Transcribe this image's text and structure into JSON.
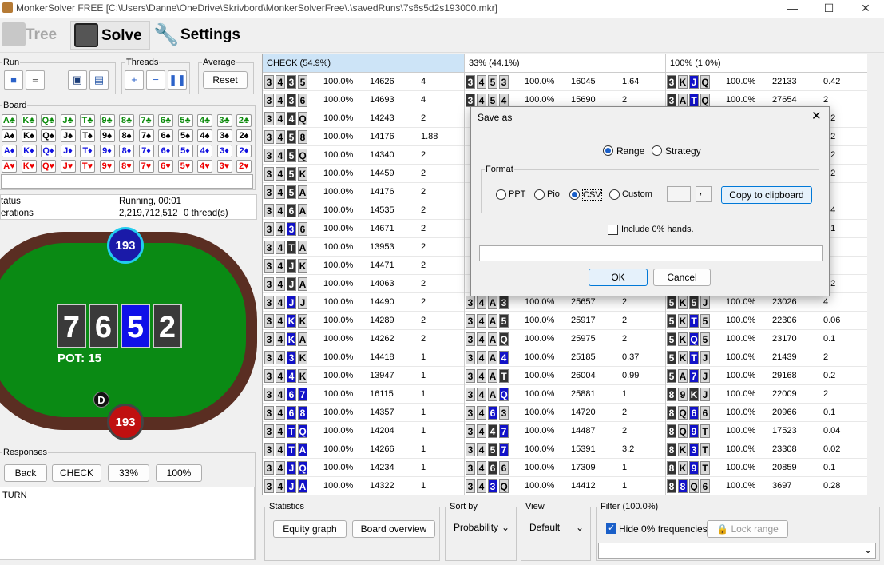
{
  "window": {
    "title": "MonkerSolver FREE [C:\\Users\\Danne\\OneDrive\\Skrivbord\\MonkerSolverFree\\.\\savedRuns\\7s6s5d2s193000.mkr]"
  },
  "toolbar": {
    "tree": "Tree",
    "solve": "Solve",
    "settings": "Settings"
  },
  "left": {
    "run_label": "Run",
    "threads_label": "Threads",
    "average_label": "Average",
    "reset": "Reset",
    "board_label": "Board",
    "board_rows": [
      {
        "suit": "c",
        "cards": [
          "A♣",
          "K♣",
          "Q♣",
          "J♣",
          "T♣",
          "9♣",
          "8♣",
          "7♣",
          "6♣",
          "5♣",
          "4♣",
          "3♣",
          "2♣"
        ]
      },
      {
        "suit": "s",
        "cards": [
          "A♠",
          "K♠",
          "Q♠",
          "J♠",
          "T♠",
          "9♠",
          "8♠",
          "7♠",
          "6♠",
          "5♠",
          "4♠",
          "3♠",
          "2♠"
        ]
      },
      {
        "suit": "d",
        "cards": [
          "A♦",
          "K♦",
          "Q♦",
          "J♦",
          "T♦",
          "9♦",
          "8♦",
          "7♦",
          "6♦",
          "5♦",
          "4♦",
          "3♦",
          "2♦"
        ]
      },
      {
        "suit": "h",
        "cards": [
          "A♥",
          "K♥",
          "Q♥",
          "J♥",
          "T♥",
          "9♥",
          "8♥",
          "7♥",
          "6♥",
          "5♥",
          "4♥",
          "3♥",
          "2♥"
        ]
      }
    ],
    "status_label": "tatus",
    "status_value": "Running, 00:01",
    "iter_label": "erations",
    "iter_value": "2,219,712,512",
    "threads_value": "0 thread(s)",
    "board_cards": [
      "7",
      "6",
      "5",
      "2"
    ],
    "pot": "POT: 15",
    "top_stack": "193",
    "bottom_stack": "193",
    "dealer": "D",
    "responses_label": "Responses",
    "resp_buttons": [
      "Back",
      "CHECK",
      "33%",
      "100%"
    ],
    "street": "TURN"
  },
  "grid": {
    "headers": [
      "CHECK (54.9%)",
      "33% (44.1%)",
      "100% (1.0%)"
    ],
    "col1": [
      {
        "h": [
          "3",
          "4",
          "3",
          "5"
        ],
        "c": [
          "n",
          "n",
          "dk",
          "n"
        ],
        "p": "100.0%",
        "n": "14626",
        "v": "4"
      },
      {
        "h": [
          "3",
          "4",
          "3",
          "6"
        ],
        "c": [
          "n",
          "n",
          "dk",
          "n"
        ],
        "p": "100.0%",
        "n": "14693",
        "v": "4"
      },
      {
        "h": [
          "3",
          "4",
          "4",
          "Q"
        ],
        "c": [
          "n",
          "n",
          "dk",
          "n"
        ],
        "p": "100.0%",
        "n": "14243",
        "v": "2"
      },
      {
        "h": [
          "3",
          "4",
          "5",
          "8"
        ],
        "c": [
          "n",
          "n",
          "dk",
          "n"
        ],
        "p": "100.0%",
        "n": "14176",
        "v": "1.88"
      },
      {
        "h": [
          "3",
          "4",
          "5",
          "Q"
        ],
        "c": [
          "n",
          "n",
          "dk",
          "n"
        ],
        "p": "100.0%",
        "n": "14340",
        "v": "2"
      },
      {
        "h": [
          "3",
          "4",
          "5",
          "K"
        ],
        "c": [
          "n",
          "n",
          "dk",
          "n"
        ],
        "p": "100.0%",
        "n": "14459",
        "v": "2"
      },
      {
        "h": [
          "3",
          "4",
          "5",
          "A"
        ],
        "c": [
          "n",
          "n",
          "dk",
          "n"
        ],
        "p": "100.0%",
        "n": "14176",
        "v": "2"
      },
      {
        "h": [
          "3",
          "4",
          "6",
          "A"
        ],
        "c": [
          "n",
          "n",
          "dk",
          "n"
        ],
        "p": "100.0%",
        "n": "14535",
        "v": "2"
      },
      {
        "h": [
          "3",
          "4",
          "3",
          "6"
        ],
        "c": [
          "n",
          "n",
          "b",
          "n"
        ],
        "p": "100.0%",
        "n": "14671",
        "v": "2"
      },
      {
        "h": [
          "3",
          "4",
          "T",
          "A"
        ],
        "c": [
          "n",
          "n",
          "dk",
          "n"
        ],
        "p": "100.0%",
        "n": "13953",
        "v": "2"
      },
      {
        "h": [
          "3",
          "4",
          "J",
          "K"
        ],
        "c": [
          "n",
          "n",
          "dk",
          "n"
        ],
        "p": "100.0%",
        "n": "14471",
        "v": "2"
      },
      {
        "h": [
          "3",
          "4",
          "J",
          "A"
        ],
        "c": [
          "n",
          "n",
          "dk",
          "n"
        ],
        "p": "100.0%",
        "n": "14063",
        "v": "2"
      },
      {
        "h": [
          "3",
          "4",
          "J",
          "J"
        ],
        "c": [
          "n",
          "n",
          "b",
          "n"
        ],
        "p": "100.0%",
        "n": "14490",
        "v": "2"
      },
      {
        "h": [
          "3",
          "4",
          "K",
          "K"
        ],
        "c": [
          "n",
          "n",
          "b",
          "n"
        ],
        "p": "100.0%",
        "n": "14289",
        "v": "2"
      },
      {
        "h": [
          "3",
          "4",
          "K",
          "A"
        ],
        "c": [
          "n",
          "n",
          "b",
          "n"
        ],
        "p": "100.0%",
        "n": "14262",
        "v": "2"
      },
      {
        "h": [
          "3",
          "4",
          "3",
          "K"
        ],
        "c": [
          "n",
          "n",
          "b",
          "n"
        ],
        "p": "100.0%",
        "n": "14418",
        "v": "1"
      },
      {
        "h": [
          "3",
          "4",
          "4",
          "K"
        ],
        "c": [
          "n",
          "n",
          "b",
          "n"
        ],
        "p": "100.0%",
        "n": "13947",
        "v": "1"
      },
      {
        "h": [
          "3",
          "4",
          "6",
          "7"
        ],
        "c": [
          "n",
          "n",
          "b",
          "b"
        ],
        "p": "100.0%",
        "n": "16115",
        "v": "1"
      },
      {
        "h": [
          "3",
          "4",
          "6",
          "8"
        ],
        "c": [
          "n",
          "n",
          "b",
          "b"
        ],
        "p": "100.0%",
        "n": "14357",
        "v": "1"
      },
      {
        "h": [
          "3",
          "4",
          "T",
          "Q"
        ],
        "c": [
          "n",
          "n",
          "b",
          "b"
        ],
        "p": "100.0%",
        "n": "14204",
        "v": "1"
      },
      {
        "h": [
          "3",
          "4",
          "T",
          "A"
        ],
        "c": [
          "n",
          "n",
          "b",
          "b"
        ],
        "p": "100.0%",
        "n": "14266",
        "v": "1"
      },
      {
        "h": [
          "3",
          "4",
          "J",
          "Q"
        ],
        "c": [
          "n",
          "n",
          "b",
          "b"
        ],
        "p": "100.0%",
        "n": "14234",
        "v": "1"
      },
      {
        "h": [
          "3",
          "4",
          "J",
          "A"
        ],
        "c": [
          "n",
          "n",
          "b",
          "b"
        ],
        "p": "100.0%",
        "n": "14322",
        "v": "1"
      }
    ],
    "col2": [
      {
        "h": [
          "3",
          "4",
          "5",
          "3"
        ],
        "c": [
          "dk",
          "n",
          "n",
          "n"
        ],
        "p": "100.0%",
        "n": "16045",
        "v": "1.64"
      },
      {
        "h": [
          "3",
          "4",
          "5",
          "4"
        ],
        "c": [
          "dk",
          "n",
          "n",
          "n"
        ],
        "p": "100.0%",
        "n": "15690",
        "v": "2"
      },
      {
        "h": [
          "",
          "",
          "",
          "",
          ""
        ],
        "c": [
          "n",
          "n",
          "n",
          "n"
        ],
        "p": "",
        "n": "",
        "v": ""
      },
      {
        "h": [
          "",
          "",
          "",
          "",
          ""
        ],
        "c": [
          "n",
          "n",
          "n",
          "n"
        ],
        "p": "",
        "n": "",
        "v": ""
      },
      {
        "h": [
          "",
          "",
          "",
          "",
          ""
        ],
        "c": [
          "n",
          "n",
          "n",
          "n"
        ],
        "p": "",
        "n": "",
        "v": ""
      },
      {
        "h": [
          "",
          "",
          "",
          "",
          ""
        ],
        "c": [
          "n",
          "n",
          "n",
          "n"
        ],
        "p": "",
        "n": "",
        "v": ""
      },
      {
        "h": [
          "",
          "",
          "",
          "",
          ""
        ],
        "c": [
          "n",
          "n",
          "n",
          "n"
        ],
        "p": "",
        "n": "",
        "v": ""
      },
      {
        "h": [
          "",
          "",
          "",
          "",
          ""
        ],
        "c": [
          "n",
          "n",
          "n",
          "n"
        ],
        "p": "",
        "n": "",
        "v": ""
      },
      {
        "h": [
          "",
          "",
          "",
          "",
          ""
        ],
        "c": [
          "n",
          "n",
          "n",
          "n"
        ],
        "p": "",
        "n": "",
        "v": ""
      },
      {
        "h": [
          "",
          "",
          "",
          "",
          ""
        ],
        "c": [
          "n",
          "n",
          "n",
          "n"
        ],
        "p": "",
        "n": "",
        "v": ""
      },
      {
        "h": [
          "",
          "",
          "",
          "",
          ""
        ],
        "c": [
          "n",
          "n",
          "n",
          "n"
        ],
        "p": "",
        "n": "",
        "v": ""
      },
      {
        "h": [
          "",
          "",
          "",
          "",
          ""
        ],
        "c": [
          "n",
          "n",
          "n",
          "n"
        ],
        "p": "",
        "n": "",
        "v": ""
      },
      {
        "h": [
          "3",
          "4",
          "A",
          "3"
        ],
        "c": [
          "n",
          "n",
          "n",
          "dk"
        ],
        "p": "100.0%",
        "n": "25657",
        "v": "2"
      },
      {
        "h": [
          "3",
          "4",
          "A",
          "5"
        ],
        "c": [
          "n",
          "n",
          "n",
          "dk"
        ],
        "p": "100.0%",
        "n": "25917",
        "v": "2"
      },
      {
        "h": [
          "3",
          "4",
          "A",
          "Q"
        ],
        "c": [
          "n",
          "n",
          "n",
          "dk"
        ],
        "p": "100.0%",
        "n": "25975",
        "v": "2"
      },
      {
        "h": [
          "3",
          "4",
          "A",
          "4"
        ],
        "c": [
          "n",
          "n",
          "n",
          "b"
        ],
        "p": "100.0%",
        "n": "25185",
        "v": "0.37"
      },
      {
        "h": [
          "3",
          "4",
          "A",
          "T"
        ],
        "c": [
          "n",
          "n",
          "n",
          "dk"
        ],
        "p": "100.0%",
        "n": "26004",
        "v": "0.99"
      },
      {
        "h": [
          "3",
          "4",
          "A",
          "Q"
        ],
        "c": [
          "n",
          "n",
          "n",
          "b"
        ],
        "p": "100.0%",
        "n": "25881",
        "v": "1"
      },
      {
        "h": [
          "3",
          "4",
          "6",
          "3"
        ],
        "c": [
          "n",
          "n",
          "b",
          "n"
        ],
        "p": "100.0%",
        "n": "14720",
        "v": "2"
      },
      {
        "h": [
          "3",
          "4",
          "4",
          "7"
        ],
        "c": [
          "n",
          "n",
          "dk",
          "b"
        ],
        "p": "100.0%",
        "n": "14487",
        "v": "2"
      },
      {
        "h": [
          "3",
          "4",
          "5",
          "7"
        ],
        "c": [
          "n",
          "n",
          "dk",
          "b"
        ],
        "p": "100.0%",
        "n": "15391",
        "v": "3.2"
      },
      {
        "h": [
          "3",
          "4",
          "6",
          "6"
        ],
        "c": [
          "n",
          "n",
          "dk",
          "n"
        ],
        "p": "100.0%",
        "n": "17309",
        "v": "1"
      },
      {
        "h": [
          "3",
          "4",
          "3",
          "Q"
        ],
        "c": [
          "n",
          "n",
          "b",
          "n"
        ],
        "p": "100.0%",
        "n": "14412",
        "v": "1"
      }
    ],
    "col3": [
      {
        "h": [
          "3",
          "K",
          "J",
          "Q"
        ],
        "c": [
          "dk",
          "n",
          "b",
          "n"
        ],
        "p": "100.0%",
        "n": "22133",
        "v": "0.42"
      },
      {
        "h": [
          "3",
          "A",
          "T",
          "Q"
        ],
        "c": [
          "dk",
          "n",
          "b",
          "n"
        ],
        "p": "100.0%",
        "n": "27654",
        "v": "2"
      },
      {
        "h": [
          "",
          "",
          "",
          ""
        ],
        "c": [
          "n",
          "n",
          "n",
          "n"
        ],
        "p": "",
        "n": "",
        "v": ".32"
      },
      {
        "h": [
          "",
          "",
          "",
          ""
        ],
        "c": [
          "n",
          "n",
          "n",
          "n"
        ],
        "p": "",
        "n": "",
        "v": ".02"
      },
      {
        "h": [
          "",
          "",
          "",
          ""
        ],
        "c": [
          "n",
          "n",
          "n",
          "n"
        ],
        "p": "",
        "n": "",
        "v": ".02"
      },
      {
        "h": [
          "",
          "",
          "",
          ""
        ],
        "c": [
          "n",
          "n",
          "n",
          "n"
        ],
        "p": "",
        "n": "",
        "v": ".52"
      },
      {
        "h": [
          "",
          "",
          "",
          ""
        ],
        "c": [
          "n",
          "n",
          "n",
          "n"
        ],
        "p": "",
        "n": "",
        "v": ""
      },
      {
        "h": [
          "",
          "",
          "",
          ""
        ],
        "c": [
          "n",
          "n",
          "n",
          "n"
        ],
        "p": "",
        "n": "",
        "v": ".04"
      },
      {
        "h": [
          "",
          "",
          "",
          ""
        ],
        "c": [
          "n",
          "n",
          "n",
          "n"
        ],
        "p": "",
        "n": "",
        "v": ".01"
      },
      {
        "h": [
          "",
          "",
          "",
          ""
        ],
        "c": [
          "n",
          "n",
          "n",
          "n"
        ],
        "p": "",
        "n": "",
        "v": ""
      },
      {
        "h": [
          "",
          "",
          "",
          ""
        ],
        "c": [
          "n",
          "n",
          "n",
          "n"
        ],
        "p": "",
        "n": "",
        "v": ""
      },
      {
        "h": [
          "",
          "",
          "",
          ""
        ],
        "c": [
          "n",
          "n",
          "n",
          "n"
        ],
        "p": "",
        "n": "",
        "v": ".22"
      },
      {
        "h": [
          "5",
          "K",
          "5",
          "J"
        ],
        "c": [
          "dk",
          "n",
          "dk",
          "n"
        ],
        "p": "100.0%",
        "n": "23026",
        "v": "4"
      },
      {
        "h": [
          "5",
          "K",
          "T",
          "5"
        ],
        "c": [
          "dk",
          "n",
          "b",
          "n"
        ],
        "p": "100.0%",
        "n": "22306",
        "v": "0.06"
      },
      {
        "h": [
          "5",
          "K",
          "Q",
          "5"
        ],
        "c": [
          "dk",
          "n",
          "b",
          "n"
        ],
        "p": "100.0%",
        "n": "23170",
        "v": "0.1"
      },
      {
        "h": [
          "5",
          "K",
          "T",
          "J"
        ],
        "c": [
          "dk",
          "n",
          "b",
          "n"
        ],
        "p": "100.0%",
        "n": "21439",
        "v": "2"
      },
      {
        "h": [
          "5",
          "A",
          "7",
          "J"
        ],
        "c": [
          "dk",
          "n",
          "b",
          "n"
        ],
        "p": "100.0%",
        "n": "29168",
        "v": "0.2"
      },
      {
        "h": [
          "8",
          "9",
          "K",
          "J"
        ],
        "c": [
          "dk",
          "n",
          "dk",
          "n"
        ],
        "p": "100.0%",
        "n": "22009",
        "v": "2"
      },
      {
        "h": [
          "8",
          "Q",
          "6",
          "6"
        ],
        "c": [
          "dk",
          "n",
          "b",
          "n"
        ],
        "p": "100.0%",
        "n": "20966",
        "v": "0.1"
      },
      {
        "h": [
          "8",
          "Q",
          "9",
          "T"
        ],
        "c": [
          "dk",
          "n",
          "b",
          "n"
        ],
        "p": "100.0%",
        "n": "17523",
        "v": "0.04"
      },
      {
        "h": [
          "8",
          "K",
          "3",
          "T"
        ],
        "c": [
          "dk",
          "n",
          "b",
          "n"
        ],
        "p": "100.0%",
        "n": "23308",
        "v": "0.02"
      },
      {
        "h": [
          "8",
          "K",
          "9",
          "T"
        ],
        "c": [
          "dk",
          "n",
          "b",
          "n"
        ],
        "p": "100.0%",
        "n": "20859",
        "v": "0.1"
      },
      {
        "h": [
          "8",
          "8",
          "Q",
          "6"
        ],
        "c": [
          "dk",
          "b",
          "n",
          "n"
        ],
        "p": "100.0%",
        "n": "3697",
        "v": "0.28"
      }
    ]
  },
  "dialog": {
    "title": "Save as",
    "range": "Range",
    "strategy": "Strategy",
    "format_label": "Format",
    "ppt": "PPT",
    "pio": "Pio",
    "csv": "CSV",
    "custom": "Custom",
    "sep_value": ",",
    "copy": "Copy to clipboard",
    "include_zero": "Include 0% hands.",
    "ok": "OK",
    "cancel": "Cancel"
  },
  "bottom": {
    "statistics_label": "Statistics",
    "equity_graph": "Equity graph",
    "board_overview": "Board overview",
    "sortby_label": "Sort by",
    "sortby_value": "Probability",
    "view_label": "View",
    "view_value": "Default",
    "filter_label": "Filter (100.0%)",
    "hide_zero": "Hide 0% frequencies",
    "lock_range": "Lock range"
  }
}
